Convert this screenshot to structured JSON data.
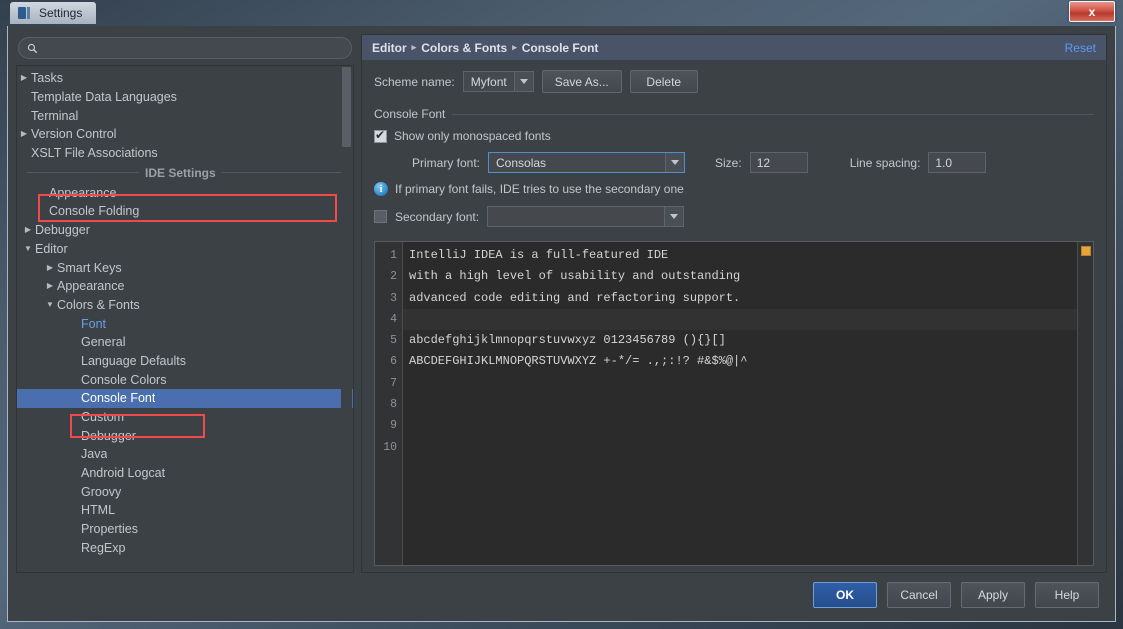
{
  "window": {
    "title": "Settings",
    "title_icon": "intellij-idea-icon",
    "close_label": "x"
  },
  "search": {
    "placeholder": "",
    "value": "",
    "icon": "search-icon"
  },
  "sidebar": {
    "items": [
      {
        "label": "Tasks",
        "arrow": "collapsed",
        "indent": 0
      },
      {
        "label": "Template Data Languages",
        "arrow": "none",
        "indent": 0
      },
      {
        "label": "Terminal",
        "arrow": "none",
        "indent": 0
      },
      {
        "label": "Version Control",
        "arrow": "collapsed",
        "indent": 0
      },
      {
        "label": "XSLT File Associations",
        "arrow": "none",
        "indent": 0
      }
    ],
    "group_header": "IDE Settings",
    "ide_items": [
      {
        "label": "Appearance",
        "arrow": "none",
        "indent": 0,
        "state": "normal"
      },
      {
        "label": "Console Folding",
        "arrow": "none",
        "indent": 0,
        "state": "normal"
      },
      {
        "label": "Debugger",
        "arrow": "collapsed",
        "indent": 0,
        "state": "normal"
      },
      {
        "label": "Editor",
        "arrow": "expanded",
        "indent": 0,
        "state": "normal"
      },
      {
        "label": "Smart Keys",
        "arrow": "collapsed",
        "indent": 1,
        "state": "normal"
      },
      {
        "label": "Appearance",
        "arrow": "collapsed",
        "indent": 1,
        "state": "normal"
      },
      {
        "label": "Colors & Fonts",
        "arrow": "expanded",
        "indent": 1,
        "state": "normal"
      },
      {
        "label": "Font",
        "arrow": "none",
        "indent": 2,
        "state": "modified"
      },
      {
        "label": "General",
        "arrow": "none",
        "indent": 2,
        "state": "normal"
      },
      {
        "label": "Language Defaults",
        "arrow": "none",
        "indent": 2,
        "state": "normal"
      },
      {
        "label": "Console Colors",
        "arrow": "none",
        "indent": 2,
        "state": "normal"
      },
      {
        "label": "Console Font",
        "arrow": "none",
        "indent": 2,
        "state": "selected"
      },
      {
        "label": "Custom",
        "arrow": "none",
        "indent": 2,
        "state": "normal"
      },
      {
        "label": "Debugger",
        "arrow": "none",
        "indent": 2,
        "state": "normal"
      },
      {
        "label": "Java",
        "arrow": "none",
        "indent": 2,
        "state": "normal"
      },
      {
        "label": "Android Logcat",
        "arrow": "none",
        "indent": 2,
        "state": "normal"
      },
      {
        "label": "Groovy",
        "arrow": "none",
        "indent": 2,
        "state": "normal"
      },
      {
        "label": "HTML",
        "arrow": "none",
        "indent": 2,
        "state": "normal"
      },
      {
        "label": "Properties",
        "arrow": "none",
        "indent": 2,
        "state": "normal"
      },
      {
        "label": "RegExp",
        "arrow": "none",
        "indent": 2,
        "state": "normal"
      }
    ]
  },
  "breadcrumb": {
    "parts": [
      "Editor",
      "Colors & Fonts",
      "Console Font"
    ],
    "separator": "▸",
    "reset_label": "Reset"
  },
  "scheme": {
    "label": "Scheme name:",
    "value": "Myfont",
    "save_as_label": "Save As...",
    "delete_label": "Delete"
  },
  "console_font": {
    "group_title": "Console Font",
    "monospaced_label": "Show only monospaced fonts",
    "monospaced_checked": true,
    "primary_font_label": "Primary font:",
    "primary_font_value": "Consolas",
    "size_label": "Size:",
    "size_value": "12",
    "line_spacing_label": "Line spacing:",
    "line_spacing_value": "1.0",
    "info_text": "If primary font fails, IDE tries to use the secondary one",
    "secondary_font_label": "Secondary font:",
    "secondary_font_value": "",
    "secondary_checked": false
  },
  "preview": {
    "line_numbers": [
      "1",
      "2",
      "3",
      "4",
      "5",
      "6",
      "7",
      "8",
      "9",
      "10"
    ],
    "lines": [
      "IntelliJ IDEA is a full-featured IDE",
      "with a high level of usability and outstanding",
      "advanced code editing and refactoring support.",
      "",
      "abcdefghijklmnopqrstuvwxyz 0123456789 (){}[]",
      "ABCDEFGHIJKLMNOPQRSTUVWXYZ +-*/= .,;:!? #&$%@|^",
      "",
      "",
      "",
      ""
    ],
    "caret_line_index": 3,
    "marker_color": "#e8a33d"
  },
  "footer": {
    "ok_label": "OK",
    "cancel_label": "Cancel",
    "apply_label": "Apply",
    "help_label": "Help"
  },
  "annotations": {
    "color": "#f24a4a",
    "targets": [
      "primary-font-field",
      "console-font-tree-item"
    ]
  }
}
